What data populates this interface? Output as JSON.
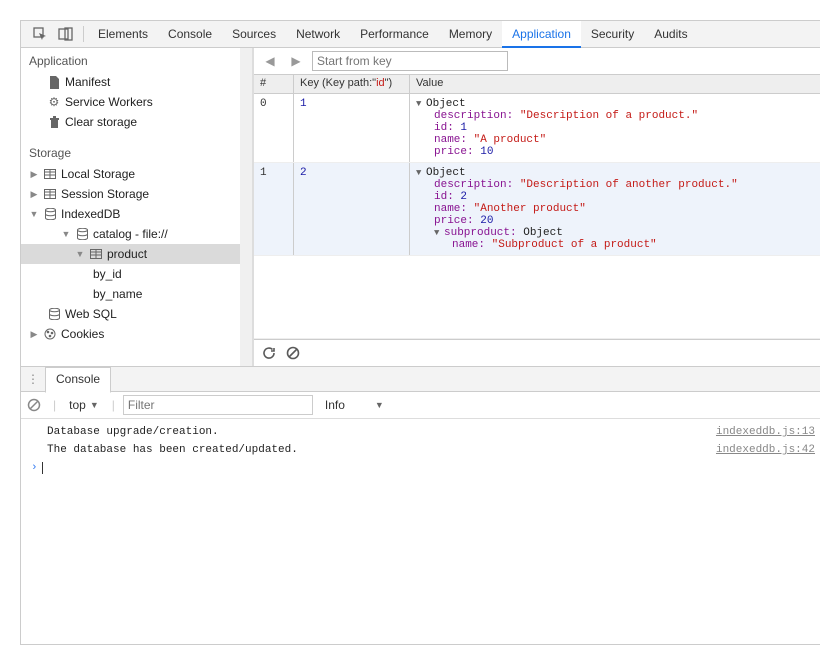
{
  "tabs": [
    "Elements",
    "Console",
    "Sources",
    "Network",
    "Performance",
    "Memory",
    "Application",
    "Security",
    "Audits"
  ],
  "active_tab": "Application",
  "sidebar": {
    "section_application": "Application",
    "manifest": "Manifest",
    "service_workers": "Service Workers",
    "clear_storage": "Clear storage",
    "section_storage": "Storage",
    "local_storage": "Local Storage",
    "session_storage": "Session Storage",
    "indexeddb": "IndexedDB",
    "catalog": "catalog - file://",
    "product": "product",
    "by_id": "by_id",
    "by_name": "by_name",
    "web_sql": "Web SQL",
    "cookies": "Cookies"
  },
  "toolbar": {
    "start_placeholder": "Start from key"
  },
  "grid": {
    "head_index": "#",
    "head_key_prefix": "Key (Key path:\"",
    "head_key_path": "id",
    "head_key_suffix": "\")",
    "head_value": "Value",
    "rows": [
      {
        "idx": "0",
        "key": "1",
        "obj": "Object",
        "props": {
          "description_k": "description:",
          "description_v": "\"Description of a product.\"",
          "id_k": "id:",
          "id_v": "1",
          "name_k": "name:",
          "name_v": "\"A product\"",
          "price_k": "price:",
          "price_v": "10"
        }
      },
      {
        "idx": "1",
        "key": "2",
        "obj": "Object",
        "props": {
          "description_k": "description:",
          "description_v": "\"Description of another product.\"",
          "id_k": "id:",
          "id_v": "2",
          "name_k": "name:",
          "name_v": "\"Another product\"",
          "price_k": "price:",
          "price_v": "20",
          "sub_k": "subproduct:",
          "sub_v": "Object",
          "sub_name_k": "name:",
          "sub_name_v": "\"Subproduct of a product\""
        }
      }
    ]
  },
  "console": {
    "tab": "Console",
    "context": "top",
    "filter_placeholder": "Filter",
    "level": "Info",
    "logs": [
      {
        "msg": "Database upgrade/creation.",
        "src": "indexeddb.js:13"
      },
      {
        "msg": "The database has been created/updated.",
        "src": "indexeddb.js:42"
      }
    ]
  }
}
